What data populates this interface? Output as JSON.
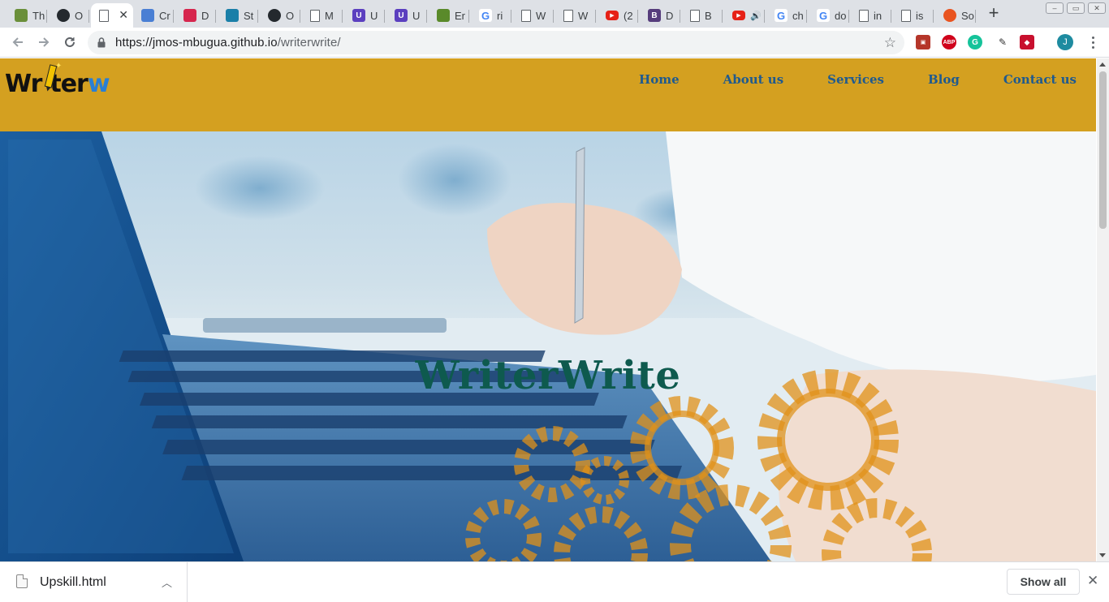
{
  "browser": {
    "tabs": [
      {
        "title": "Th",
        "icon": "plant-icon",
        "color": "#6a8f3a"
      },
      {
        "title": "O",
        "icon": "github-icon",
        "color": "#24292e"
      },
      {
        "title": "",
        "icon": "page-icon",
        "color": "#ffffff",
        "active": true
      },
      {
        "title": "Cr",
        "icon": "cloud-icon",
        "color": "#4a7fd4"
      },
      {
        "title": "D",
        "icon": "diamond-icon",
        "color": "#d6264e"
      },
      {
        "title": "St",
        "icon": "shield-icon",
        "color": "#1a7fa8"
      },
      {
        "title": "O",
        "icon": "github-icon",
        "color": "#24292e"
      },
      {
        "title": "M",
        "icon": "page-icon",
        "color": "#ffffff"
      },
      {
        "title": "U",
        "icon": "upwork-icon",
        "color": "#5b3fbf"
      },
      {
        "title": "U",
        "icon": "upwork-icon",
        "color": "#5b3fbf"
      },
      {
        "title": "Er",
        "icon": "lizard-icon",
        "color": "#5a8a2a"
      },
      {
        "title": "ri",
        "icon": "google-icon",
        "color": "#4285f4"
      },
      {
        "title": "W",
        "icon": "page-icon",
        "color": "#ffffff"
      },
      {
        "title": "W",
        "icon": "page-icon",
        "color": "#ffffff"
      },
      {
        "title": "(2",
        "icon": "youtube-icon",
        "color": "#e62117"
      },
      {
        "title": "D",
        "icon": "bootstrap-icon",
        "color": "#563d7c"
      },
      {
        "title": "B",
        "icon": "page-icon",
        "color": "#ffffff"
      },
      {
        "title": "",
        "icon": "youtube-icon",
        "color": "#e62117",
        "audio": true
      },
      {
        "title": "ch",
        "icon": "google-icon",
        "color": "#4285f4"
      },
      {
        "title": "do",
        "icon": "google-icon",
        "color": "#4285f4"
      },
      {
        "title": "in",
        "icon": "page-icon",
        "color": "#ffffff"
      },
      {
        "title": "is",
        "icon": "page-icon",
        "color": "#ffffff"
      },
      {
        "title": "So",
        "icon": "ubuntu-icon",
        "color": "#e95420"
      }
    ],
    "url_host": "https://jmos-mbugua.github.io",
    "url_path": "/writerwrite/",
    "profile_initial": "J"
  },
  "site": {
    "logo": {
      "part1": "Wr",
      "part2": "ter",
      "part3": "w"
    },
    "nav": [
      "Home",
      "About us",
      "Services",
      "Blog",
      "Contact us"
    ],
    "hero_title": "WriterWrite"
  },
  "downloads": {
    "file_name": "Upskill.html",
    "show_all_label": "Show all"
  },
  "colors": {
    "header_bg": "#d4a020",
    "nav_link": "#1f5a8f",
    "hero_title": "#0e5a4e"
  }
}
